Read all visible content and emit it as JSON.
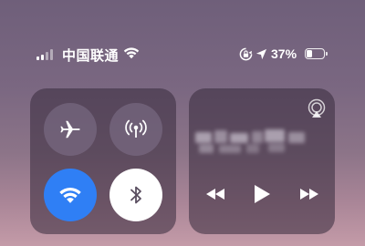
{
  "status_bar": {
    "carrier": "中国联通",
    "battery_percent": "37%",
    "battery_level": 0.37,
    "signal_bars_active": 2,
    "signal_bars_total": 4,
    "icons": [
      "signal-icon",
      "wifi-icon",
      "rotation-lock-icon",
      "location-arrow-icon",
      "battery-icon"
    ]
  },
  "connectivity": {
    "airplane_mode": {
      "icon": "airplane-icon",
      "on": false
    },
    "cellular_data": {
      "icon": "cellular-antenna-icon",
      "on": false
    },
    "wifi": {
      "icon": "wifi-icon",
      "on": true,
      "color": "#2f7ff5"
    },
    "bluetooth": {
      "icon": "bluetooth-icon",
      "on": true,
      "color": "#ffffff"
    }
  },
  "now_playing": {
    "title": "",
    "airplay_icon": "airplay-icon",
    "controls": [
      "rewind-icon",
      "play-icon",
      "fast-forward-icon"
    ]
  }
}
